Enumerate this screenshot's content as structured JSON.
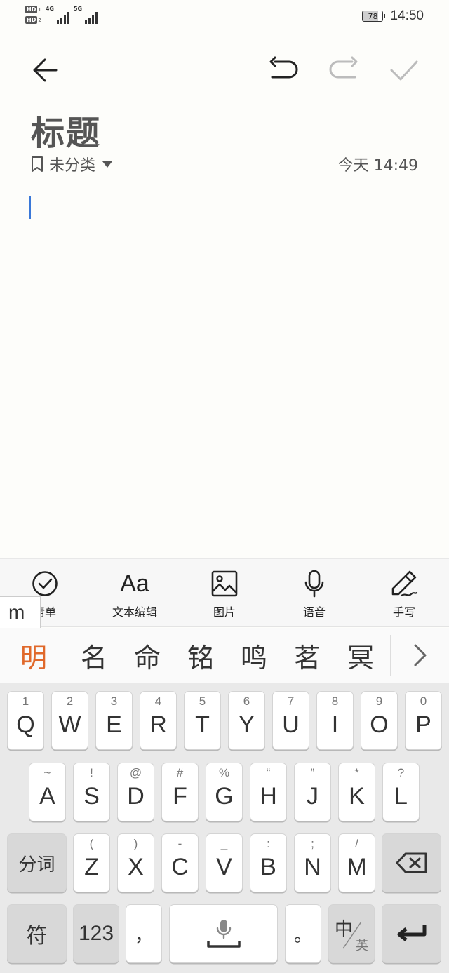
{
  "status": {
    "sim1": "HD",
    "sim1_index": "1",
    "sim2": "HD",
    "sim2_index": "2",
    "net1": "4G",
    "net2": "5G",
    "battery": "78",
    "time": "14:50"
  },
  "note": {
    "title": "标题",
    "category": "未分类",
    "date": "今天 14:49"
  },
  "edit_tools": [
    {
      "label": "清单",
      "icon": "checklist-icon"
    },
    {
      "label": "文本编辑",
      "icon": "text-format-icon",
      "glyph": "Aa"
    },
    {
      "label": "图片",
      "icon": "image-icon"
    },
    {
      "label": "语音",
      "icon": "microphone-icon"
    },
    {
      "label": "手写",
      "icon": "pen-icon"
    }
  ],
  "composing_text": "m",
  "candidates": [
    "明",
    "名",
    "命",
    "铭",
    "鸣",
    "茗",
    "冥"
  ],
  "keyboard": {
    "row1": [
      {
        "k": "Q",
        "s": "1"
      },
      {
        "k": "W",
        "s": "2"
      },
      {
        "k": "E",
        "s": "3"
      },
      {
        "k": "R",
        "s": "4"
      },
      {
        "k": "T",
        "s": "5"
      },
      {
        "k": "Y",
        "s": "6"
      },
      {
        "k": "U",
        "s": "7"
      },
      {
        "k": "I",
        "s": "8"
      },
      {
        "k": "O",
        "s": "9"
      },
      {
        "k": "P",
        "s": "0"
      }
    ],
    "row2": [
      {
        "k": "A",
        "s": "~"
      },
      {
        "k": "S",
        "s": "!"
      },
      {
        "k": "D",
        "s": "@"
      },
      {
        "k": "F",
        "s": "#"
      },
      {
        "k": "G",
        "s": "%"
      },
      {
        "k": "H",
        "s": "“"
      },
      {
        "k": "J",
        "s": "”"
      },
      {
        "k": "K",
        "s": "*"
      },
      {
        "k": "L",
        "s": "?"
      }
    ],
    "row3": [
      {
        "k": "Z",
        "s": "("
      },
      {
        "k": "X",
        "s": ")"
      },
      {
        "k": "C",
        "s": "-"
      },
      {
        "k": "V",
        "s": "_"
      },
      {
        "k": "B",
        "s": ":"
      },
      {
        "k": "N",
        "s": ";"
      },
      {
        "k": "M",
        "s": "/"
      }
    ],
    "segment_label": "分词",
    "symbol_label": "符",
    "numbers_label": "123",
    "comma": "，",
    "period": "。",
    "lang_main": "中",
    "lang_alt": "英"
  },
  "colors": {
    "candidate_highlight": "#e0682a",
    "cursor": "#3a78d8"
  }
}
